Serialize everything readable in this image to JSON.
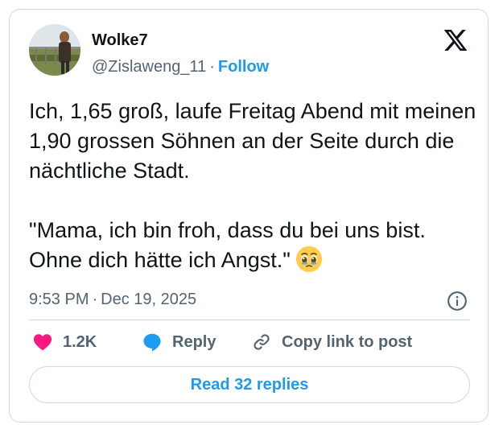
{
  "author": {
    "name": "Wolke7",
    "handle": "@Zislaweng_11",
    "separator": "·",
    "follow_label": "Follow"
  },
  "tweet": {
    "paragraphs": [
      "Ich, 1,65 groß, laufe Freitag Abend mit meinen 1,90 grossen Söhnen an der Seite durch die nächtliche Stadt.",
      "\"Mama, ich bin froh, dass du bei uns bist. Ohne dich hätte ich Angst.\""
    ],
    "emoji": "face-holding-back-tears"
  },
  "meta": {
    "time": "9:53 PM",
    "separator": "·",
    "date": "Dec 19, 2025"
  },
  "actions": {
    "like_count": "1.2K",
    "reply_label": "Reply",
    "copy_label": "Copy link to post"
  },
  "read_replies_label": "Read 32 replies",
  "colors": {
    "accent": "#1d9bf0",
    "like": "#f91880",
    "text": "#0f1419",
    "secondary": "#536471",
    "border": "#cfd9de"
  },
  "icons": [
    "x-logo-icon",
    "info-icon",
    "heart-icon",
    "reply-bubble-icon",
    "link-icon"
  ]
}
